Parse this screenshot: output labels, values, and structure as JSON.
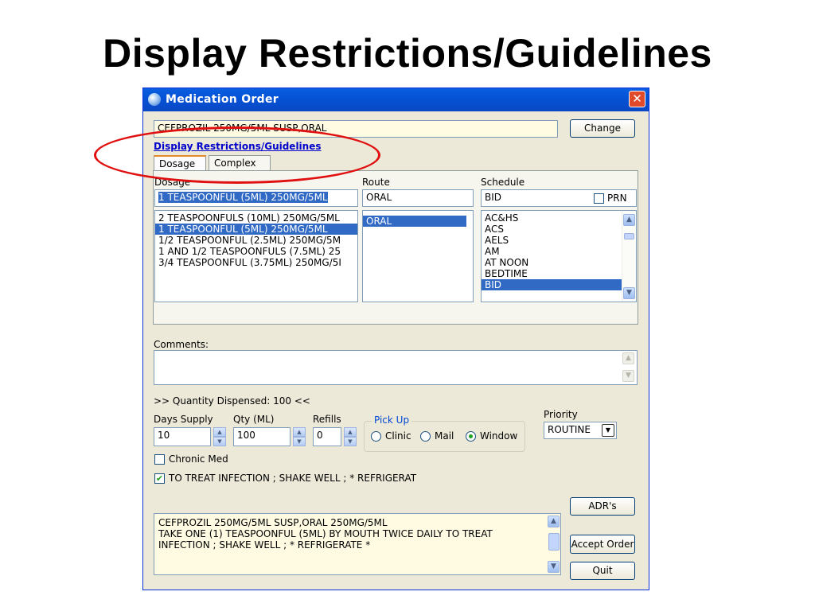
{
  "slide": {
    "title": "Display Restrictions/Guidelines"
  },
  "window": {
    "title": "Medication Order",
    "close_glyph": "✕"
  },
  "medication": {
    "name": "CEFPROZIL 250MG/5ML SUSP,ORAL",
    "change_label": "Change"
  },
  "restrictions_link": "Display Restrictions/Guidelines",
  "tabs": [
    {
      "label": "Dosage"
    },
    {
      "label": "Complex"
    }
  ],
  "dosage": {
    "label": "Dosage",
    "value": "1 TEASPOONFUL (5ML) 250MG/5ML",
    "options": [
      {
        "text": "2 TEASPOONFULS (10ML) 250MG/5ML",
        "selected": false
      },
      {
        "text": "1 TEASPOONFUL (5ML) 250MG/5ML",
        "selected": true
      },
      {
        "text": "1/2 TEASPOONFUL (2.5ML) 250MG/5M",
        "selected": false
      },
      {
        "text": "1 AND 1/2 TEASPOONFULS (7.5ML) 25",
        "selected": false
      },
      {
        "text": "3/4 TEASPOONFUL (3.75ML) 250MG/5I",
        "selected": false
      }
    ]
  },
  "route": {
    "label": "Route",
    "value": "ORAL",
    "options": [
      {
        "text": "ORAL",
        "selected": true
      }
    ]
  },
  "schedule": {
    "label": "Schedule",
    "value": "BID",
    "prn_label": "PRN",
    "options": [
      {
        "text": "AC&HS",
        "selected": false
      },
      {
        "text": "ACS",
        "selected": false
      },
      {
        "text": "AELS",
        "selected": false
      },
      {
        "text": "AM",
        "selected": false
      },
      {
        "text": "AT NOON",
        "selected": false
      },
      {
        "text": "BEDTIME",
        "selected": false
      },
      {
        "text": "BID",
        "selected": true
      }
    ]
  },
  "comments": {
    "label": "Comments:",
    "value": ""
  },
  "quantity_dispensed": ">> Quantity Dispensed: 100 <<",
  "days_supply": {
    "label": "Days Supply",
    "value": "10"
  },
  "qty": {
    "label": "Qty (ML)",
    "value": "100"
  },
  "refills": {
    "label": "Refills",
    "value": "0"
  },
  "pickup": {
    "legend": "Pick Up",
    "options": [
      {
        "label": "Clinic",
        "selected": false
      },
      {
        "label": "Mail",
        "selected": false
      },
      {
        "label": "Window",
        "selected": true
      }
    ]
  },
  "priority": {
    "label": "Priority",
    "value": "ROUTINE"
  },
  "chronic_med": {
    "label": "Chronic Med",
    "checked": false
  },
  "patient_instructions": {
    "label": "TO TREAT INFECTION ; SHAKE WELL ; * REFRIGERAT",
    "checked": true,
    "check_glyph": "✔"
  },
  "order_summary": [
    "CEFPROZIL 250MG/5ML SUSP,ORAL  250MG/5ML",
    "TAKE ONE (1) TEASPOONFUL (5ML) BY MOUTH TWICE DAILY TO TREAT",
    "INFECTION ; SHAKE WELL ; * REFRIGERATE *"
  ],
  "buttons": {
    "adrs": "ADR's",
    "accept": "Accept Order",
    "quit": "Quit"
  },
  "annotation": {
    "color": "#e01010"
  }
}
